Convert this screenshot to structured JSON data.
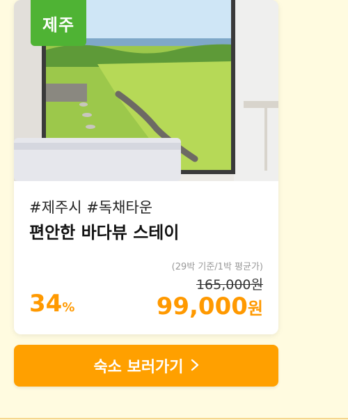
{
  "card": {
    "region_badge": "제주",
    "tags": "#제주시 #독채타운",
    "title": "편안한 바다뷰 스테이",
    "price_note": "(29박 기준/1박 평균가)",
    "original_price": "165,000원",
    "discount_number": "34",
    "discount_unit": "%",
    "sale_amount": "99,000",
    "sale_unit": "원"
  },
  "cta": {
    "label": "숙소 보러가기",
    "icon": "chevron-right-icon"
  },
  "colors": {
    "background": "#fffbe0",
    "accent": "#ff9900",
    "cta": "#ffa000",
    "region_badge": "#4fb334"
  }
}
